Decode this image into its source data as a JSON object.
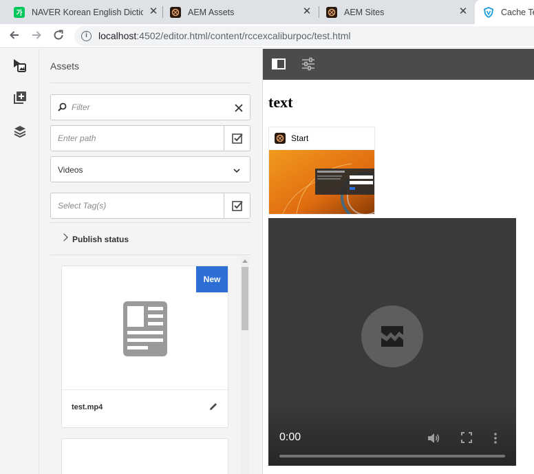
{
  "browser": {
    "tabs": [
      {
        "title": "NAVER Korean English Dictiona",
        "favicon": "naver-icon",
        "color": "#03c75a",
        "active": false
      },
      {
        "title": "AEM Assets",
        "favicon": "aem-icon",
        "color": "#2b1a0f",
        "active": false
      },
      {
        "title": "AEM Sites",
        "favicon": "aem-icon",
        "color": "#2b1a0f",
        "active": false
      },
      {
        "title": "Cache Tes",
        "favicon": "shield-icon",
        "color": "#1a73e8",
        "active": true
      }
    ],
    "url_host": "localhost",
    "url_rest": ":4502/editor.html/content/rccexcaliburpoc/test.html"
  },
  "rail": {
    "items": [
      {
        "name": "assets-icon"
      },
      {
        "name": "components-icon"
      },
      {
        "name": "content-tree-icon"
      }
    ]
  },
  "panel": {
    "title": "Assets",
    "filter_placeholder": "Filter",
    "path_placeholder": "Enter path",
    "type_value": "Videos",
    "tags_placeholder": "Select Tag(s)",
    "publish_label": "Publish status",
    "cards": [
      {
        "badge": "New",
        "name": "test.mp4"
      },
      {
        "badge": "",
        "name": ""
      }
    ]
  },
  "editor": {
    "heading": "text",
    "start_label": "Start",
    "video_time": "0:00"
  },
  "colors": {
    "accent": "#2d6fd4",
    "toolbar": "#4b4b4b",
    "video_bg": "#3a3a3a"
  }
}
